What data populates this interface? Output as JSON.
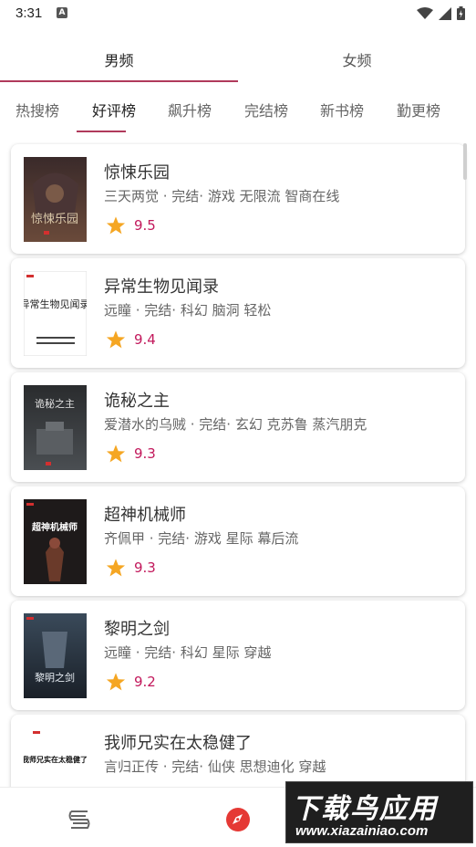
{
  "status_bar": {
    "time": "3:31",
    "notification_letter": "A"
  },
  "gender_tabs": [
    {
      "label": "男频",
      "active": true
    },
    {
      "label": "女频",
      "active": false
    }
  ],
  "rank_tabs": [
    {
      "label": "热搜榜",
      "active": false
    },
    {
      "label": "好评榜",
      "active": true
    },
    {
      "label": "飙升榜",
      "active": false
    },
    {
      "label": "完结榜",
      "active": false
    },
    {
      "label": "新书榜",
      "active": false
    },
    {
      "label": "勤更榜",
      "active": false
    }
  ],
  "books": [
    {
      "title": "惊悚乐园",
      "meta": "三天两觉 · 完结· 游戏 无限流 智商在线",
      "rating": "9.5",
      "cover_text": "惊悚乐园"
    },
    {
      "title": "异常生物见闻录",
      "meta": "远瞳 · 完结· 科幻 脑洞 轻松",
      "rating": "9.4",
      "cover_text": "异常生物见闻录"
    },
    {
      "title": "诡秘之主",
      "meta": "爱潜水的乌贼 · 完结· 玄幻 克苏鲁 蒸汽朋克",
      "rating": "9.3",
      "cover_text": "诡秘之主"
    },
    {
      "title": "超神机械师",
      "meta": "齐佩甲 · 完结· 游戏 星际 幕后流",
      "rating": "9.3",
      "cover_text": "超神机械师"
    },
    {
      "title": "黎明之剑",
      "meta": "远瞳 · 完结· 科幻 星际 穿越",
      "rating": "9.2",
      "cover_text": "黎明之剑"
    },
    {
      "title": "我师兄实在太稳健了",
      "meta": "言归正传 · 完结· 仙侠 思想迪化 穿越",
      "rating": "",
      "cover_text": "我师兄实在太稳健了"
    }
  ],
  "bottom_nav": [
    {
      "icon": "bookshelf-icon"
    },
    {
      "icon": "compass-icon"
    }
  ],
  "watermark": {
    "title": "下载鸟应用",
    "url": "www.xiazainiao.com"
  },
  "colors": {
    "accent": "#b03a5b",
    "rating": "#c2185b",
    "star": "#f5a623"
  }
}
